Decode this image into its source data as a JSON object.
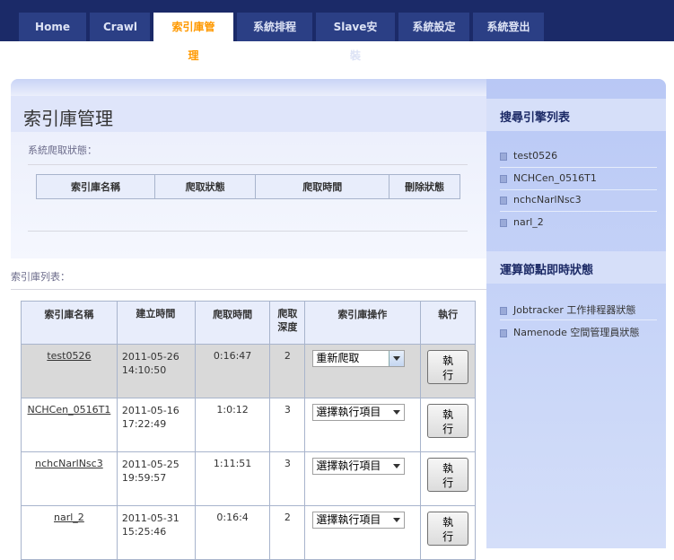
{
  "nav": {
    "tabs": [
      {
        "label": "Home"
      },
      {
        "label": "Crawl"
      },
      {
        "label": "索引庫管理"
      },
      {
        "label": "系統排程"
      },
      {
        "label": "Slave安裝"
      },
      {
        "label": "系統設定"
      },
      {
        "label": "系統登出"
      }
    ],
    "active": "索引庫管理"
  },
  "main": {
    "title": "索引庫管理",
    "crawl_status_label": "系統爬取狀態：",
    "crawl_status_table": {
      "headers": [
        "索引庫名稱",
        "爬取狀態",
        "爬取時間",
        "刪除狀態"
      ]
    },
    "index_list_label": "索引庫列表：",
    "index_table": {
      "headers": [
        "索引庫名稱",
        "建立時間",
        "爬取時間",
        "爬取深度",
        "索引庫操作",
        "執行"
      ],
      "rows": [
        {
          "name": "test0526",
          "created_date": "2011-05-26",
          "created_time": "14:10:50",
          "crawl_time": "0:16:47",
          "depth": "2",
          "operation": "重新爬取",
          "execute": "執行"
        },
        {
          "name": "NCHCen_0516T1",
          "created_date": "2011-05-16",
          "created_time": "17:22:49",
          "crawl_time": "1:0:12",
          "depth": "3",
          "operation": "選擇執行項目",
          "execute": "執行"
        },
        {
          "name": "nchcNarlNsc3",
          "created_date": "2011-05-25",
          "created_time": "19:59:57",
          "crawl_time": "1:11:51",
          "depth": "3",
          "operation": "選擇執行項目",
          "execute": "執行"
        },
        {
          "name": "narl_2",
          "created_date": "2011-05-31",
          "created_time": "15:25:46",
          "crawl_time": "0:16:4",
          "depth": "2",
          "operation": "選擇執行項目",
          "execute": "執行"
        }
      ]
    }
  },
  "sidebar": {
    "engines_title": "搜尋引擎列表",
    "engines": [
      "test0526",
      "NCHCen_0516T1",
      "nchcNarlNsc3",
      "narl_2"
    ],
    "nodes_title": "運算節點即時狀態",
    "nodes": [
      "Jobtracker 工作排程器狀態",
      "Namenode 空間管理員狀態"
    ]
  },
  "colors": {
    "nav_bg": "#1b2a68",
    "active_tab_text": "#ff9900",
    "sidebar_bg": "#c9d6f8"
  }
}
